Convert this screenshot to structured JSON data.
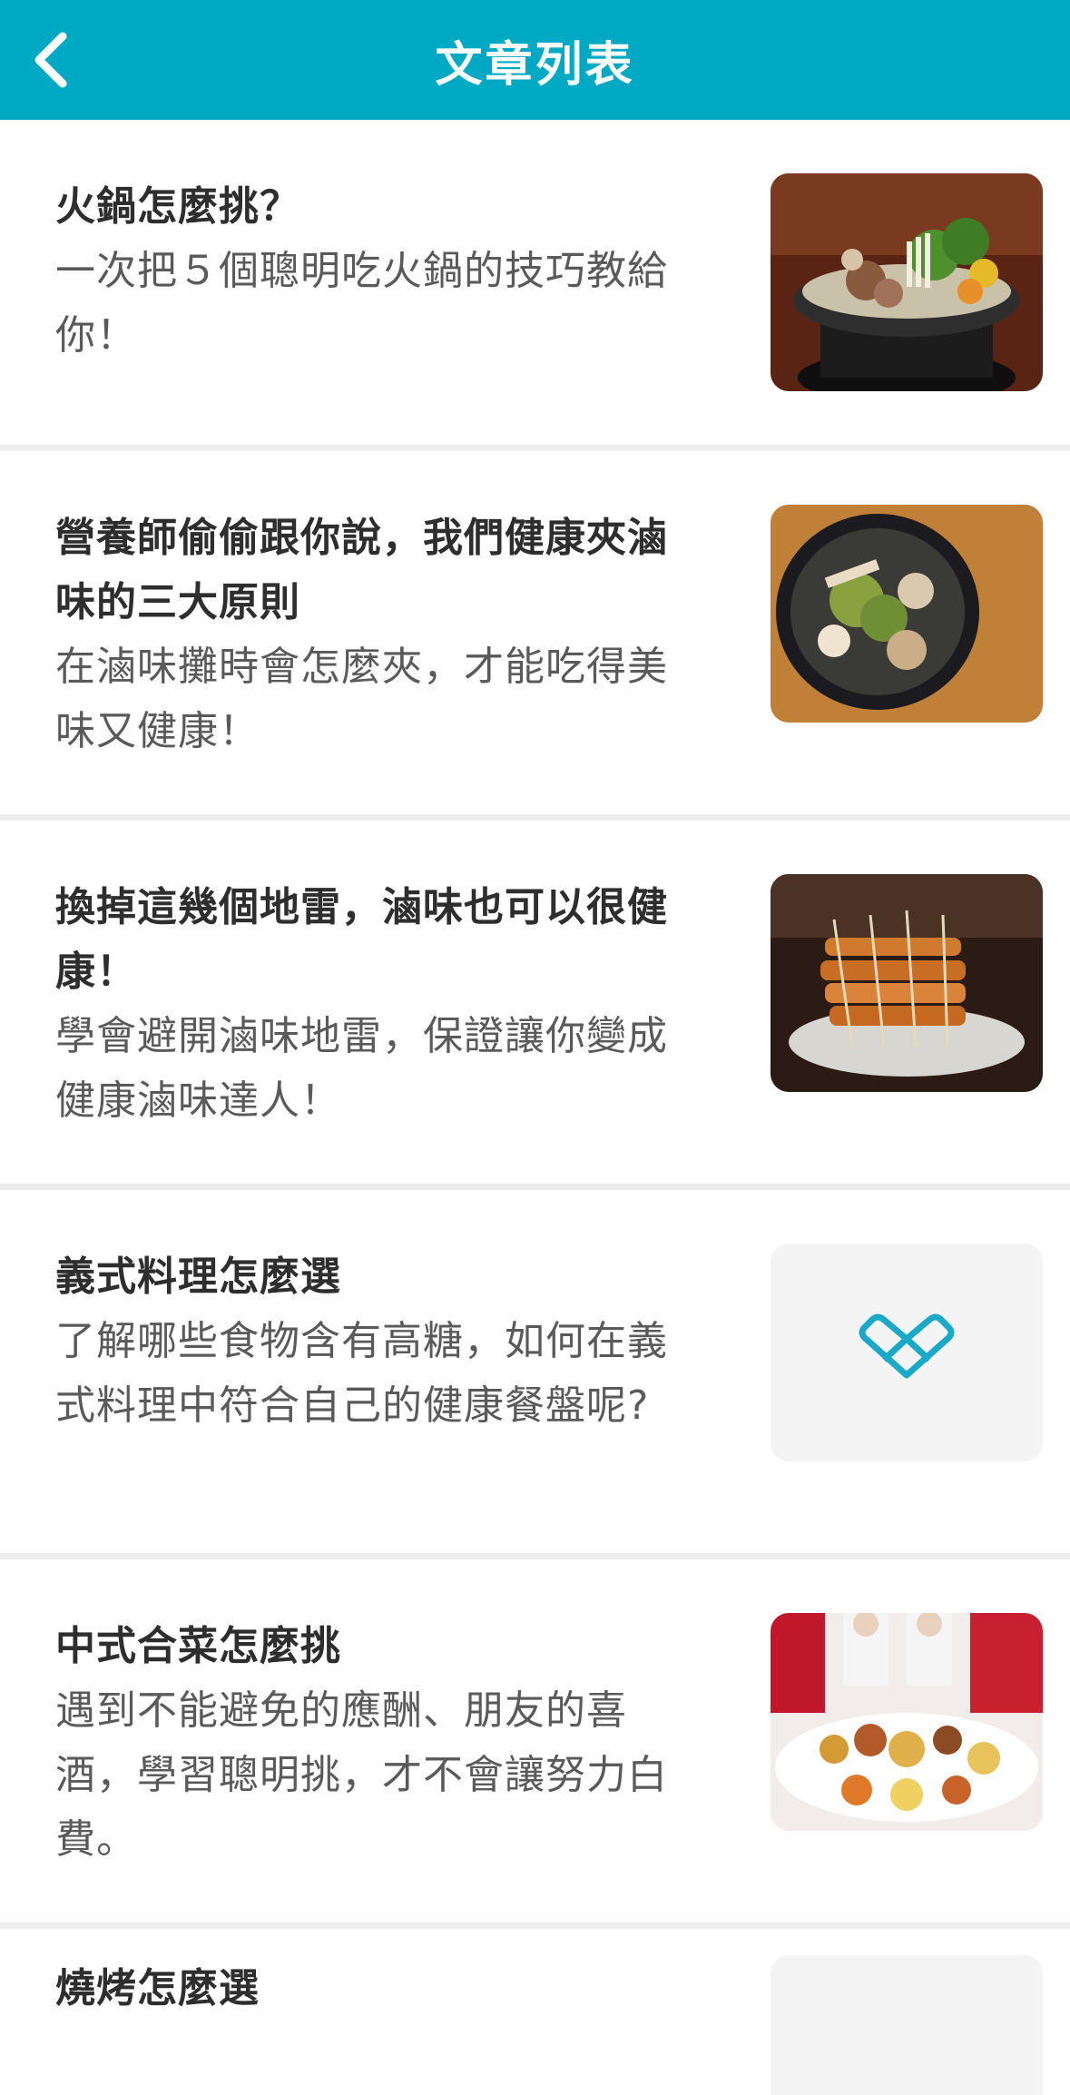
{
  "header": {
    "title": "文章列表",
    "back_icon": "chevron-left-icon"
  },
  "articles": [
    {
      "title": "火鍋怎麼挑？",
      "subtitle": "一次把５個聰明吃火鍋的技巧教給你！",
      "image": "hotpot-photo"
    },
    {
      "title": "營養師偷偷跟你說，我們健康夾滷味的三大原則",
      "subtitle": "在滷味攤時會怎麼夾，才能吃得美味又健康！",
      "image": "braised-dish-photo"
    },
    {
      "title": "換掉這幾個地雷，滷味也可以很健康！",
      "subtitle": "學會避開滷味地雷，保證讓你變成健康滷味達人！",
      "image": "skewers-photo"
    },
    {
      "title": "義式料理怎麼選",
      "subtitle": "了解哪些食物含有高糖，如何在義式料理中符合自己的健康餐盤呢?",
      "image": "app-logo-placeholder"
    },
    {
      "title": "中式合菜怎麼挑",
      "subtitle": "遇到不能避免的應酬、朋友的喜酒，學習聰明挑，才不會讓努力白費。",
      "image": "banquet-photo"
    },
    {
      "title": "燒烤怎麼選",
      "subtitle": "",
      "image": "placeholder"
    }
  ],
  "colors": {
    "header": "#00a9c3",
    "accent": "#1aa9c6"
  }
}
